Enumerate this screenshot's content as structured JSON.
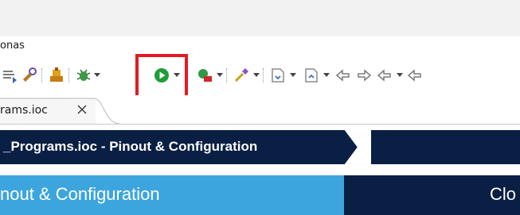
{
  "menubar": {
    "partial_item": "onas"
  },
  "toolbar": {
    "items": [
      {
        "icon": "format-icon"
      },
      {
        "icon": "build-config-icon"
      },
      {
        "icon": "build-icon"
      },
      {
        "icon": "debug-bug-icon"
      },
      {
        "icon": "run-play-icon"
      },
      {
        "icon": "external-tools-icon"
      },
      {
        "icon": "pin-editor-icon"
      },
      {
        "icon": "next-annotation-icon"
      },
      {
        "icon": "previous-annotation-icon"
      },
      {
        "icon": "last-edit-location-icon"
      },
      {
        "icon": "back-arrow-icon"
      },
      {
        "icon": "forward-arrow-icon"
      }
    ],
    "highlight_color": "#e21b23"
  },
  "editor_tab": {
    "label": "rams.ioc",
    "close_glyph": "×"
  },
  "breadcrumb": {
    "label": "_Programs.ioc - Pinout & Configuration"
  },
  "sections": {
    "left_label": "nout & Configuration",
    "right_label": "Clo"
  },
  "colors": {
    "navy": "#0a1f44",
    "light_blue": "#3da5de",
    "run_green": "#1f9d3a"
  }
}
